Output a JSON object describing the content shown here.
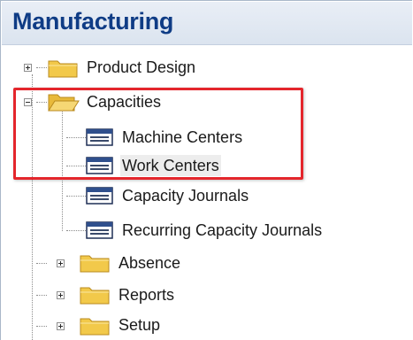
{
  "header": {
    "title": "Manufacturing"
  },
  "tree": {
    "product_design": "Product Design",
    "capacities": "Capacities",
    "machine_centers": "Machine Centers",
    "work_centers": "Work Centers",
    "capacity_journals": "Capacity Journals",
    "recurring_capacity_journals": "Recurring Capacity Journals",
    "absence": "Absence",
    "reports": "Reports",
    "setup": "Setup"
  },
  "icons": {
    "folder": "folder-icon",
    "folder_open": "folder-open-icon",
    "form": "form-icon"
  },
  "colors": {
    "header_text": "#0f3c85",
    "highlight_border": "#e4262c",
    "folder": "#f2c94a"
  }
}
